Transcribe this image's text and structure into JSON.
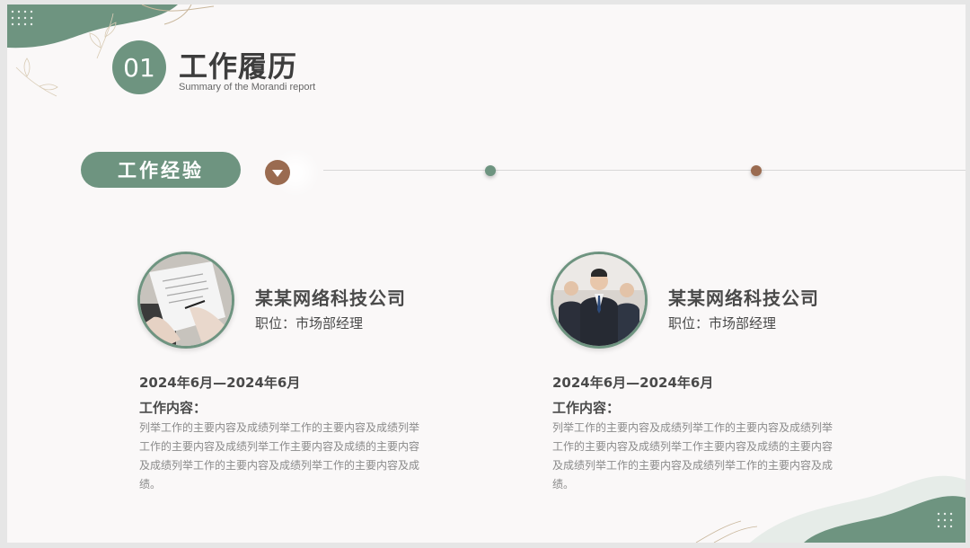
{
  "header": {
    "number": "01",
    "title": "工作履历",
    "subtitle": "Summary of the Morandi report"
  },
  "section": {
    "label": "工作经验"
  },
  "colors": {
    "green": "#6e9480",
    "brown": "#9a6b50",
    "text_dark": "#4a4a4a",
    "text_gray": "#8a8a8a"
  },
  "cards": [
    {
      "image": "document-signing-photo",
      "company": "某某网络科技公司",
      "position": "职位：市场部经理",
      "date": "2024年6月—2024年6月",
      "content_label": "工作内容：",
      "content": "列举工作的主要内容及成绩列举工作的主要内容及成绩列举工作的主要内容及成绩列举工作主要内容及成绩的主要内容及成绩列举工作的主要内容及成绩列举工作的主要内容及成绩。"
    },
    {
      "image": "business-team-photo",
      "company": "某某网络科技公司",
      "position": "职位：市场部经理",
      "date": "2024年6月—2024年6月",
      "content_label": "工作内容：",
      "content": "列举工作的主要内容及成绩列举工作的主要内容及成绩列举工作的主要内容及成绩列举工作主要内容及成绩的主要内容及成绩列举工作的主要内容及成绩列举工作的主要内容及成绩。"
    }
  ]
}
